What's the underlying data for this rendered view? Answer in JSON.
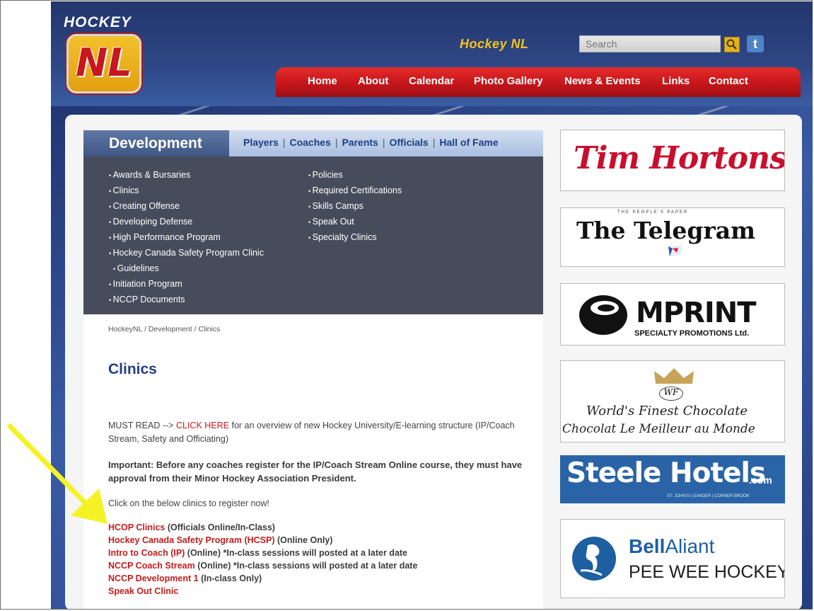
{
  "header": {
    "logo_word": "HOCKEY",
    "logo_mark": "NL",
    "site_name": "Hockey NL",
    "search_placeholder": "Search",
    "twitter_glyph": "t"
  },
  "nav": {
    "items": [
      "Home",
      "About",
      "Calendar",
      "Photo Gallery",
      "News & Events",
      "Links",
      "Contact"
    ]
  },
  "section": {
    "title": "Development",
    "links": [
      "Players",
      "Coaches",
      "Parents",
      "Officials",
      "Hall of Fame"
    ],
    "separators": [
      "|",
      "|",
      "|",
      "|"
    ]
  },
  "menu": {
    "left": [
      "Awards & Bursaries",
      "Clinics",
      "Creating Offense",
      "Developing Defense",
      "High Performance Program",
      "Hockey Canada Safety Program Clinic",
      "Guidelines",
      "Initiation Program",
      "NCCP Documents"
    ],
    "right": [
      "Policies",
      "Required Certifications",
      "Skills Camps",
      "Speak Out",
      "Specialty Clinics"
    ]
  },
  "breadcrumb": "HockeyNL  /  Development  /  Clinics",
  "page_title": "Clinics",
  "content": {
    "must_read_prefix": "MUST READ --> ",
    "click_here": "CLICK HERE",
    "must_read_suffix": " for an overview of new Hockey University/E-learning structure (IP/Coach Stream, Safety and Officiating)",
    "important": "Important: Before any coaches register for the IP/Coach Stream Online course, they must have approval from their Minor Hockey Association President.",
    "click_below": "Click on the below clinics to register now!",
    "clinics": [
      {
        "link": "HCOP Clinics",
        "note": " (Officials Online/In-Class)"
      },
      {
        "link": "Hockey Canada Safety Program (HCSP)",
        "note": "  (Online Only)"
      },
      {
        "link": "Intro to Coach (IP)",
        "note": " (Online) *In-class sessions will posted at a later date"
      },
      {
        "link": "NCCP Coach Stream",
        "note": " (Online)  *In-class sessions will posted at a later date"
      },
      {
        "link": "NCCP Development 1",
        "note": " (In-class Only)"
      },
      {
        "link": "Speak Out Clinic",
        "note": ""
      }
    ]
  },
  "sponsors": {
    "tim_hortons": "Tim Hortons",
    "telegram_tagline": "THE PEOPLE'S PAPER",
    "telegram": "The Telegram",
    "imprint": "MPRINT",
    "imprint_sub": "SPECIALTY PROMOTIONS Ltd.",
    "wf_mark": "WF",
    "wf_line1": "World's Finest Chocolate",
    "wf_line2": "Chocolat Le Meilleur au Monde",
    "steele": "Steele Hotels",
    "steele_com": ".com",
    "steele_sub": "ST. JOHN'S | GANDER | CORNER BROOK",
    "bell": "Bell",
    "aliant": "Aliant",
    "bell_sub": "PEE WEE HOCKEY"
  },
  "colors": {
    "nav_red": "#c5161b",
    "link_red": "#c41c1c",
    "title_blue": "#24407e",
    "arrow_yellow": "#f4f225",
    "steele_blue": "#2a64a6"
  }
}
